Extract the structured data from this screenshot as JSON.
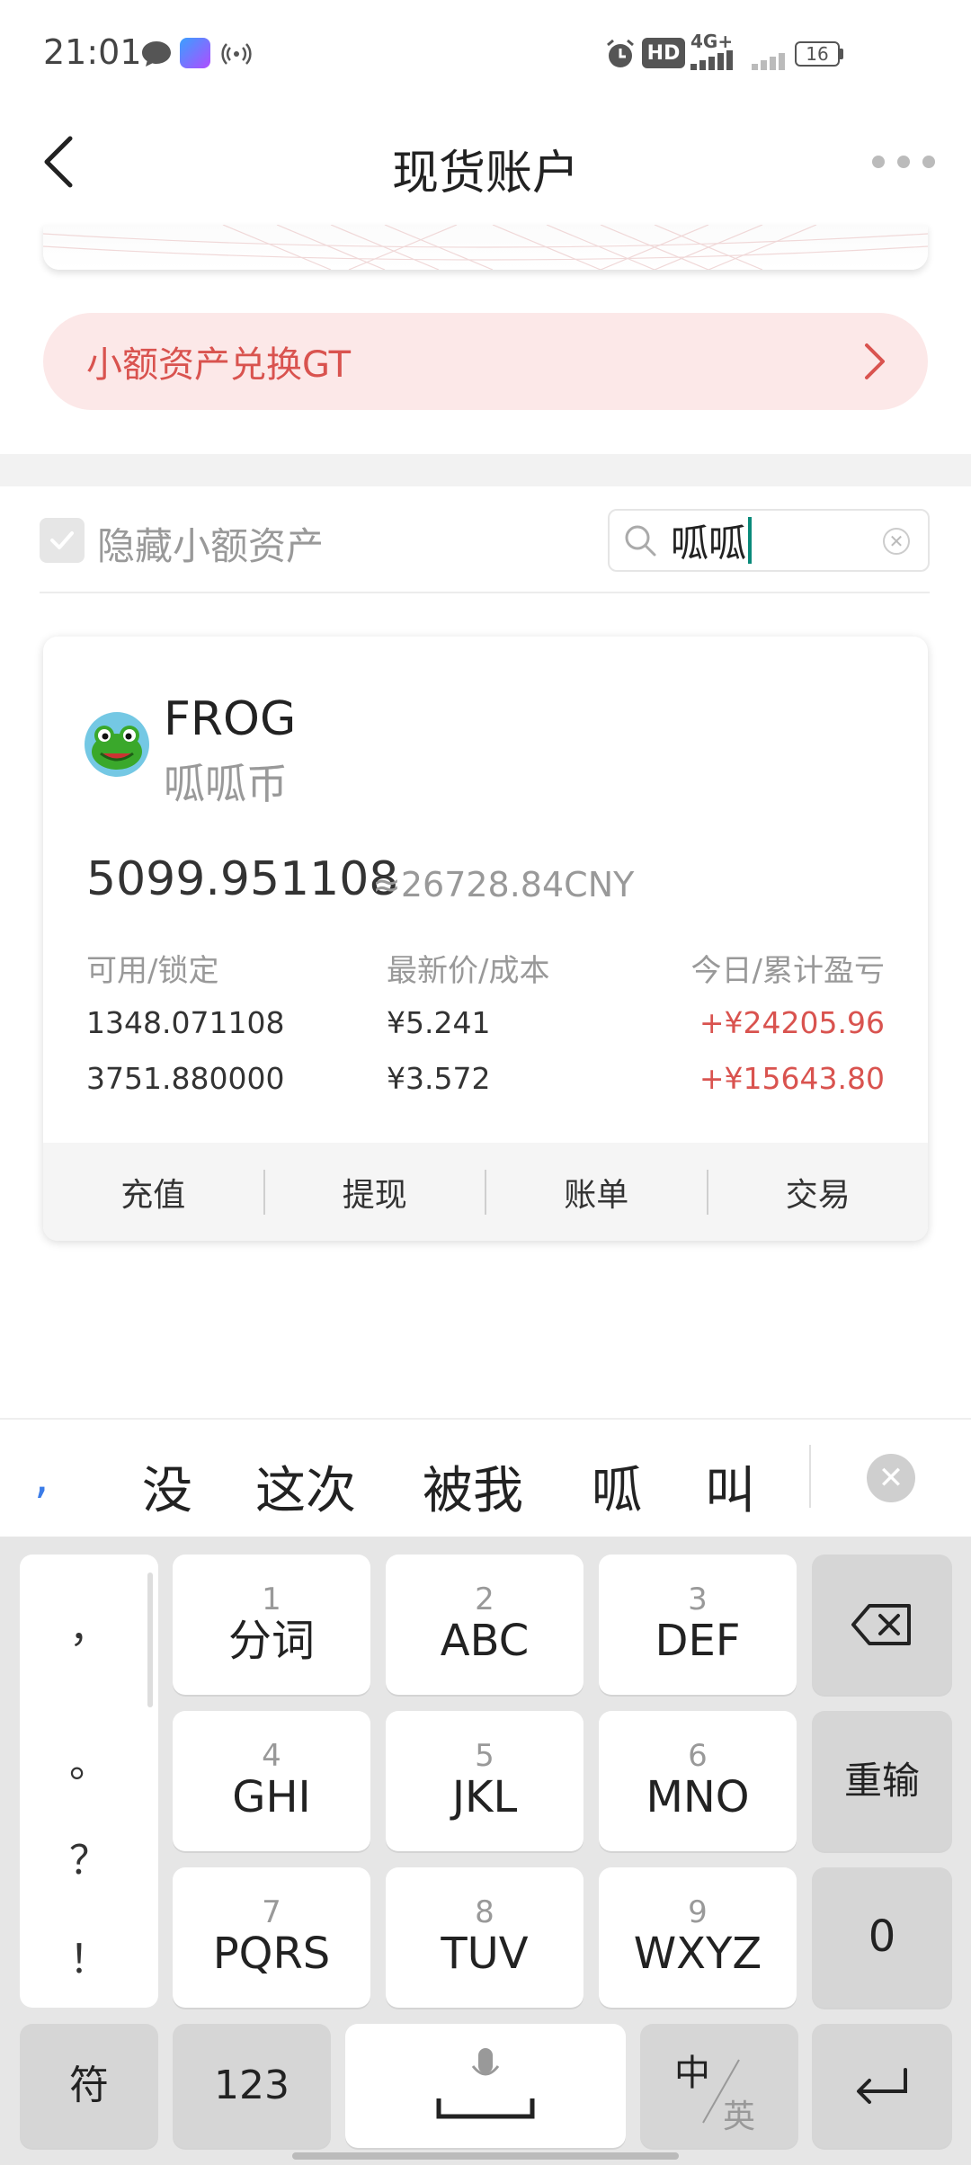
{
  "status_bar": {
    "time": "21:01",
    "icons": [
      "message-icon",
      "app-notification-icon",
      "hotspot-icon",
      "alarm-icon",
      "hd-icon",
      "signal-4g-icon",
      "signal-icon",
      "battery-icon"
    ],
    "network_label": "4G+",
    "hd_label": "HD",
    "battery_level": "16"
  },
  "header": {
    "title": "现货账户",
    "back_icon": "chevron-left-icon",
    "more_icon": "more-horizontal-icon"
  },
  "promo_banner": {
    "text": "小额资产兑换GT",
    "icon": "chevron-right-icon"
  },
  "filter": {
    "hide_small_label": "隐藏小额资产",
    "hide_small_checked": true,
    "search_value": "呱呱",
    "search_placeholder": ""
  },
  "asset": {
    "symbol": "FROG",
    "name": "呱呱币",
    "total": "5099.951108",
    "cny_value": "≈26728.84CNY",
    "headers": {
      "available_locked": "可用/锁定",
      "price_cost": "最新价/成本",
      "pnl": "今日/累计盈亏"
    },
    "rows": [
      {
        "amount": "1348.071108",
        "price": "¥5.241",
        "pnl": "+¥24205.96"
      },
      {
        "amount": "3751.880000",
        "price": "¥3.572",
        "pnl": "+¥15643.80"
      }
    ],
    "actions": [
      "充值",
      "提现",
      "账单",
      "交易"
    ]
  },
  "ime": {
    "comma": ",",
    "candidates": [
      "没",
      "这次",
      "被我",
      "呱",
      "叫"
    ],
    "close_icon": "close-icon"
  },
  "keyboard": {
    "punctuation": [
      "，",
      "。",
      "？",
      "！"
    ],
    "keys": [
      {
        "num": "1",
        "label": "分词"
      },
      {
        "num": "2",
        "label": "ABC"
      },
      {
        "num": "3",
        "label": "DEF"
      },
      {
        "num": "4",
        "label": "GHI"
      },
      {
        "num": "5",
        "label": "JKL"
      },
      {
        "num": "6",
        "label": "MNO"
      },
      {
        "num": "7",
        "label": "PQRS"
      },
      {
        "num": "8",
        "label": "TUV"
      },
      {
        "num": "9",
        "label": "WXYZ"
      }
    ],
    "backspace_icon": "backspace-icon",
    "reenter_label": "重输",
    "zero_label": "0",
    "symbol_label": "符",
    "numeric_label": "123",
    "space_icon": "space-bar-icon",
    "mic_icon": "microphone-icon",
    "lang_top": "中",
    "lang_bottom": "英",
    "enter_icon": "enter-icon"
  },
  "colors": {
    "accent_red": "#d9534f",
    "promo_bg": "#fce8e8",
    "caret": "#0a8a7a",
    "keyboard_bg": "#e6e6e6"
  }
}
